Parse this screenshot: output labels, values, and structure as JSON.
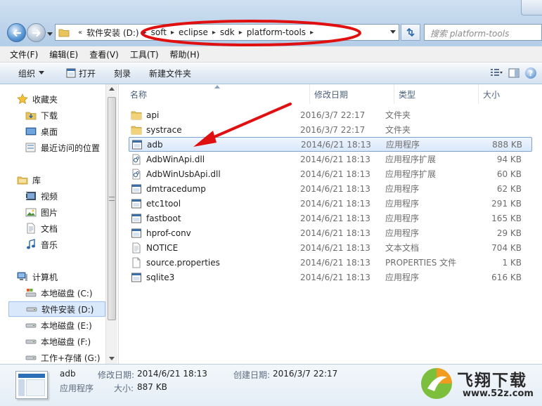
{
  "window": {
    "address": {
      "overflow_marker": "«",
      "crumbs": [
        "软件安装 (D:)",
        "soft",
        "eclipse",
        "sdk",
        "platform-tools"
      ]
    },
    "search_placeholder": "搜索 platform-tools"
  },
  "menubar": {
    "items": [
      "文件(F)",
      "编辑(E)",
      "查看(V)",
      "工具(T)",
      "帮助(H)"
    ]
  },
  "toolbar": {
    "organize": "组织",
    "open": "打开",
    "burn": "刻录",
    "new_folder": "新建文件夹"
  },
  "nav": {
    "favorites": "收藏夹",
    "downloads": "下载",
    "desktop": "桌面",
    "recent": "最近访问的位置",
    "libraries": "库",
    "videos": "视频",
    "pictures": "图片",
    "documents": "文档",
    "music": "音乐",
    "computer": "计算机",
    "drive_c": "本地磁盘 (C:)",
    "drive_d": "软件安装 (D:)",
    "drive_e": "本地磁盘 (E:)",
    "drive_f": "本地磁盘 (F:)",
    "drive_g": "工作+存储 (G:)"
  },
  "columns": {
    "name": "名称",
    "date": "修改日期",
    "type": "类型",
    "size": "大小"
  },
  "files": [
    {
      "name": "api",
      "date": "2016/3/7 22:17",
      "type": "文件夹",
      "size": "",
      "icon": "folder-icon"
    },
    {
      "name": "systrace",
      "date": "2016/3/7 22:17",
      "type": "文件夹",
      "size": "",
      "icon": "folder-icon"
    },
    {
      "name": "adb",
      "date": "2014/6/21 18:13",
      "type": "应用程序",
      "size": "888 KB",
      "icon": "application-icon"
    },
    {
      "name": "AdbWinApi.dll",
      "date": "2014/6/21 18:13",
      "type": "应用程序扩展",
      "size": "94 KB",
      "icon": "dll-icon"
    },
    {
      "name": "AdbWinUsbApi.dll",
      "date": "2014/6/21 18:13",
      "type": "应用程序扩展",
      "size": "60 KB",
      "icon": "dll-icon"
    },
    {
      "name": "dmtracedump",
      "date": "2014/6/21 18:13",
      "type": "应用程序",
      "size": "62 KB",
      "icon": "application-icon"
    },
    {
      "name": "etc1tool",
      "date": "2014/6/21 18:13",
      "type": "应用程序",
      "size": "291 KB",
      "icon": "application-icon"
    },
    {
      "name": "fastboot",
      "date": "2014/6/21 18:13",
      "type": "应用程序",
      "size": "165 KB",
      "icon": "application-icon"
    },
    {
      "name": "hprof-conv",
      "date": "2014/6/21 18:13",
      "type": "应用程序",
      "size": "29 KB",
      "icon": "application-icon"
    },
    {
      "name": "NOTICE",
      "date": "2014/6/21 18:13",
      "type": "文本文档",
      "size": "704 KB",
      "icon": "text-file-icon"
    },
    {
      "name": "source.properties",
      "date": "2014/6/21 18:13",
      "type": "PROPERTIES 文件",
      "size": "1 KB",
      "icon": "generic-file-icon"
    },
    {
      "name": "sqlite3",
      "date": "2014/6/21 18:13",
      "type": "应用程序",
      "size": "616 KB",
      "icon": "application-icon"
    }
  ],
  "details": {
    "name": "adb",
    "type": "应用程序",
    "modified_label": "修改日期:",
    "modified_value": "2014/6/21 18:13",
    "created_label": "创建日期:",
    "created_value": "2016/3/7 22:17",
    "size_label": "大小:",
    "size_value": "887 KB"
  },
  "watermark": {
    "title": "飞翔下载",
    "url": "www.52z.com"
  },
  "colors": {
    "selection": "#d9e8fb",
    "annotation_red": "#e01010"
  }
}
